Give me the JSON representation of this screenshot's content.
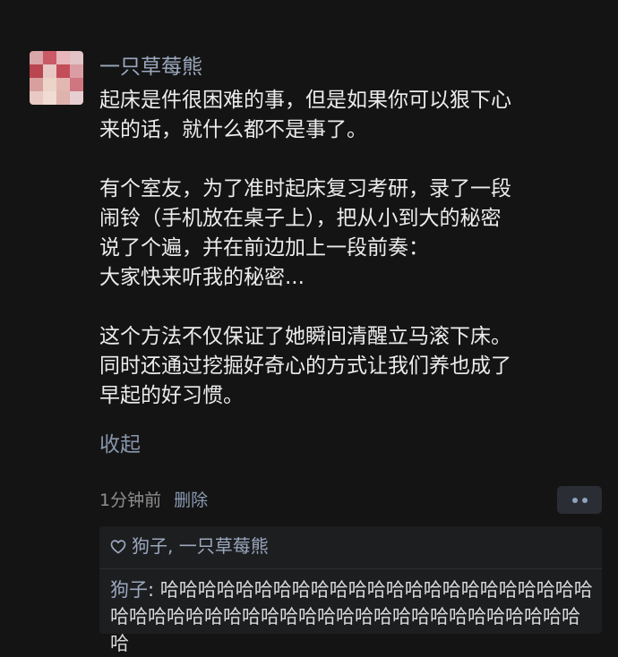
{
  "comment": {
    "author": "一只草莓熊",
    "paragraphs": [
      [
        "起床是件很困难的事，但是如果你可以狠下心",
        "来的话，就什么都不是事了。"
      ],
      [
        "有个室友，为了准时起床复习考研，录了一段",
        "闹铃（手机放在桌子上），把从小到大的秘密",
        "说了个遍，并在前边加上一段前奏：",
        "大家快来听我的秘密..."
      ],
      [
        "这个方法不仅保证了她瞬间清醒立马滚下床。",
        "同时还通过挖掘好奇心的方式让我们养也成了",
        "早起的好习惯。"
      ]
    ],
    "collapse_label": "收起",
    "time": "1分钟前",
    "delete_label": "删除"
  },
  "reply_box": {
    "likes": "狗子, 一只草莓熊",
    "reply": {
      "author": "狗子",
      "separator": ": ",
      "text": "哈哈哈哈哈哈哈哈哈哈哈哈哈哈哈哈哈哈哈哈哈哈哈哈哈哈哈哈哈哈哈哈哈哈哈哈哈哈哈哈哈哈哈哈哈哈哈哈哈"
    }
  },
  "icons": {
    "avatar": "avatar-image",
    "like": "heart-outline-icon",
    "more": "more-dots-icon"
  },
  "colors": {
    "background": "#141414",
    "link": "#9ba8be",
    "text": "#ececec"
  }
}
